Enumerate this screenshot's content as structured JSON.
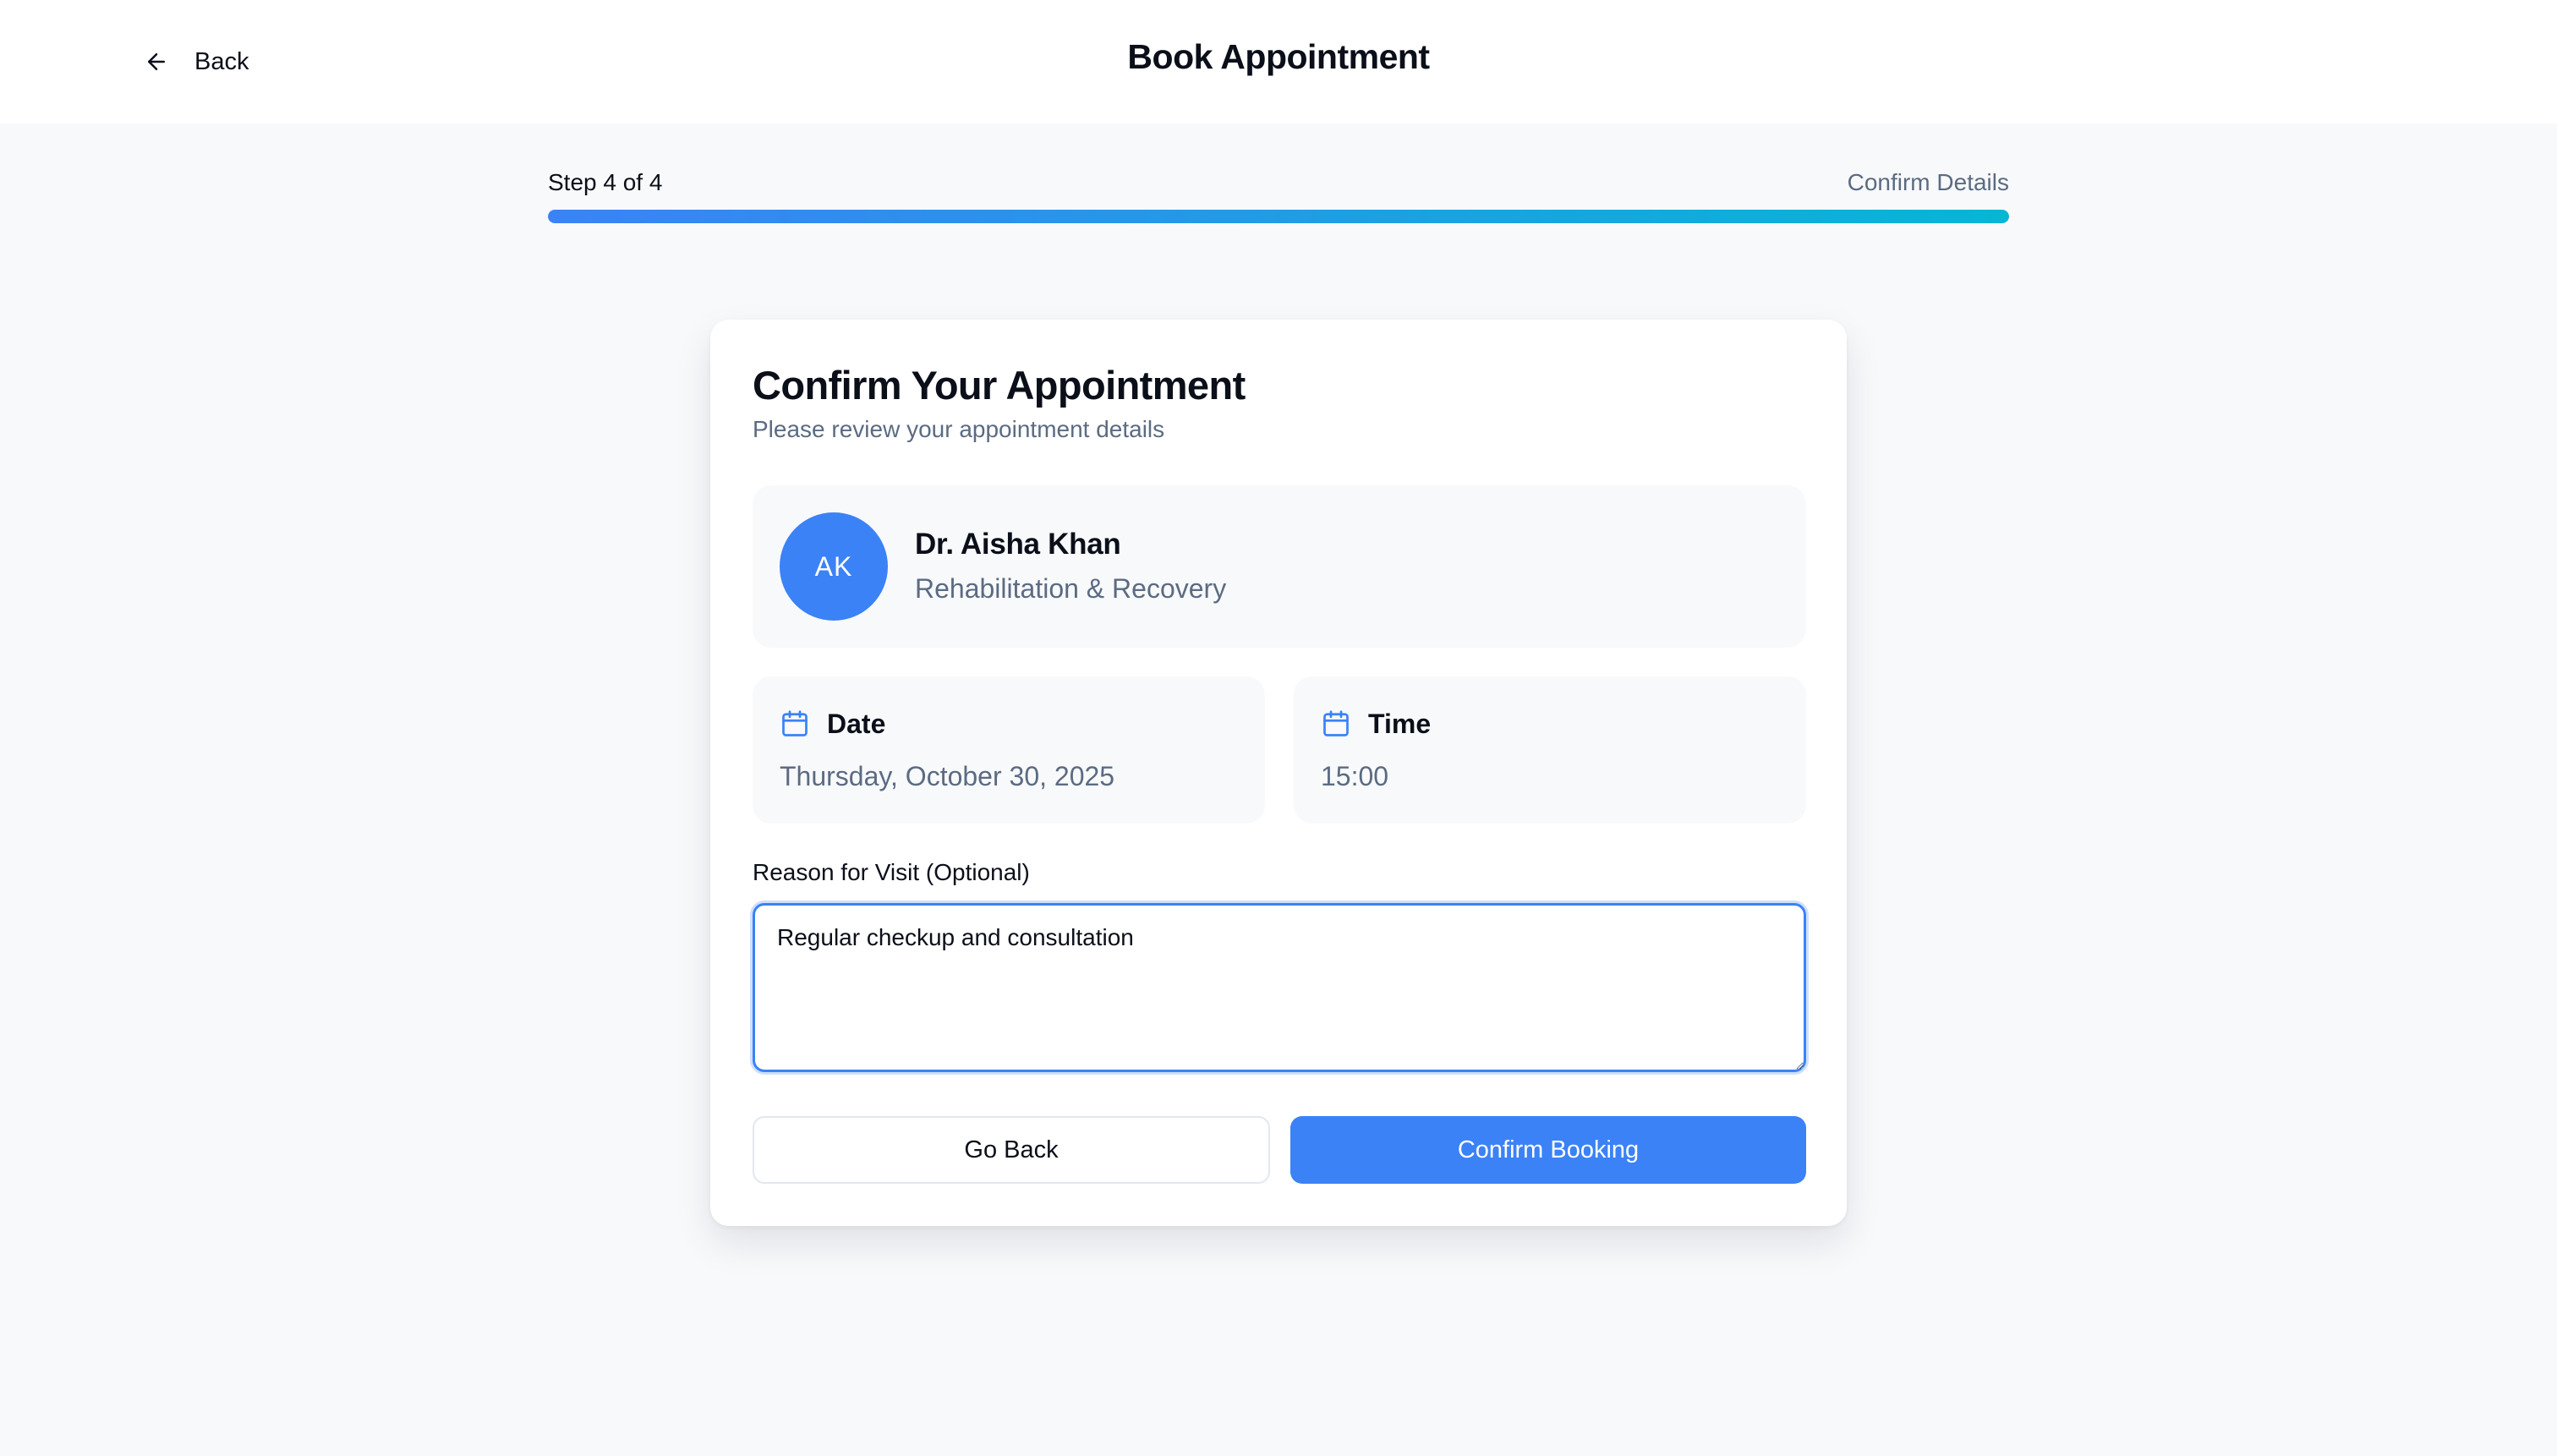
{
  "header": {
    "back_label": "Back",
    "title": "Book Appointment"
  },
  "progress": {
    "step_text": "Step 4 of 4",
    "step_name": "Confirm Details",
    "fraction": 1.0,
    "gradient_start": "#3b82f6",
    "gradient_end": "#06b6d4"
  },
  "card": {
    "title": "Confirm Your Appointment",
    "subtitle": "Please review your appointment details",
    "doctor": {
      "initials": "AK",
      "name": "Dr. Aisha Khan",
      "specialty": "Rehabilitation & Recovery",
      "avatar_color": "#3b82f6"
    },
    "date": {
      "icon": "calendar-icon",
      "label": "Date",
      "value": "Thursday, October 30, 2025"
    },
    "time": {
      "icon": "calendar-icon",
      "label": "Time",
      "value": "15:00"
    },
    "reason": {
      "label": "Reason for Visit (Optional)",
      "value": "Regular checkup and consultation"
    },
    "buttons": {
      "go_back": "Go Back",
      "confirm": "Confirm Booking"
    }
  },
  "colors": {
    "accent": "#3b82f6",
    "muted_text": "#5b6b82",
    "background": "#f8f9fb"
  }
}
